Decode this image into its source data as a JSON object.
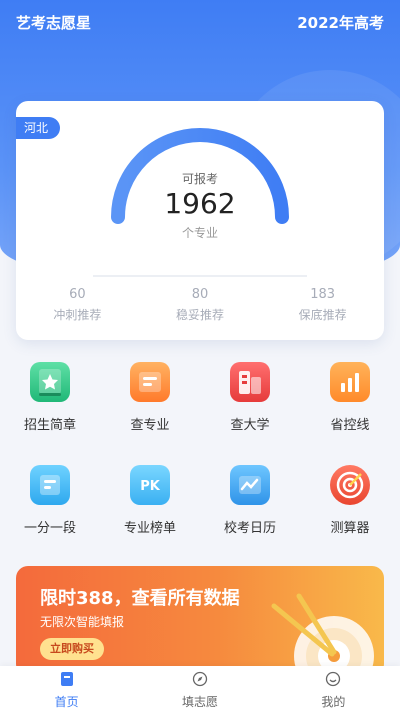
{
  "header": {
    "app_name": "艺考志愿星",
    "exam_year": "2022年高考"
  },
  "summary": {
    "province": "河北",
    "gauge_caption": "可报考",
    "majors_count": "1962",
    "majors_unit": "个专业",
    "stats": [
      {
        "value": "60",
        "label": "冲刺推荐"
      },
      {
        "value": "80",
        "label": "稳妥推荐"
      },
      {
        "value": "183",
        "label": "保底推荐"
      }
    ]
  },
  "features": [
    {
      "label": "招生简章",
      "icon": "admission-guide-icon"
    },
    {
      "label": "查专业",
      "icon": "major-search-icon"
    },
    {
      "label": "查大学",
      "icon": "university-search-icon"
    },
    {
      "label": "省控线",
      "icon": "province-line-icon"
    },
    {
      "label": "一分一段",
      "icon": "score-segment-icon"
    },
    {
      "label": "专业榜单",
      "icon": "pk-ranking-icon"
    },
    {
      "label": "校考日历",
      "icon": "exam-calendar-icon"
    },
    {
      "label": "测算器",
      "icon": "target-calculator-icon"
    }
  ],
  "banner": {
    "title": "限时388，查看所有数据",
    "subtitle": "无限次智能填报",
    "button": "立即购买"
  },
  "tabbar": [
    {
      "label": "首页",
      "icon": "home-icon",
      "active": true
    },
    {
      "label": "填志愿",
      "icon": "compass-icon",
      "active": false
    },
    {
      "label": "我的",
      "icon": "profile-smile-icon",
      "active": false
    }
  ],
  "colors": {
    "primary": "#3f7df4",
    "banner_start": "#f46a3c",
    "banner_end": "#f9b94a"
  }
}
